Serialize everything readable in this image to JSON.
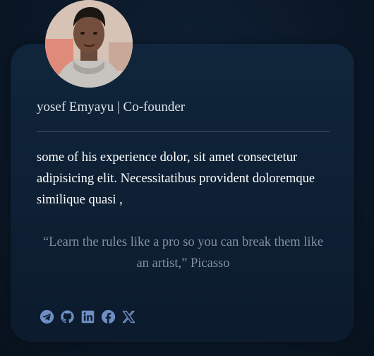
{
  "profile": {
    "name_line": "yosef Emyayu | Co-founder",
    "bio": "some of his experience dolor, sit amet consectetur adipisicing elit. Necessitatibus provident doloremque similique quasi ,",
    "quote": "“Learn the rules like a pro so you can break them like an artist,” Picasso"
  },
  "social_icons": [
    "telegram-icon",
    "github-icon",
    "linkedin-icon",
    "facebook-icon",
    "x-icon"
  ],
  "colors": {
    "accent": "#6f8fc4",
    "name_text": "#dfe4ea",
    "bio_text": "#ffffff",
    "quote_text": "#8391a2",
    "card_background": "#0e2034",
    "page_background": "#0a1422"
  }
}
